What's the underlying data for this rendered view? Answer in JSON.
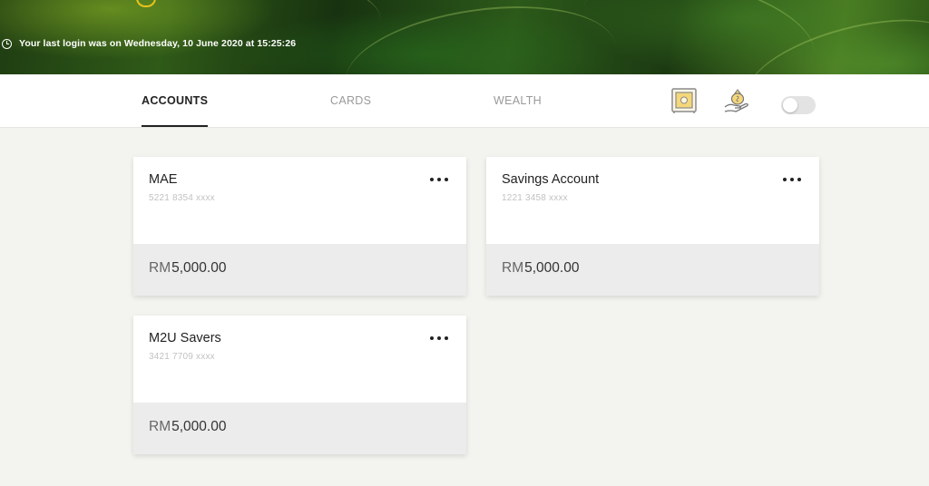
{
  "banner": {
    "last_login": "Your last login was on Wednesday, 10 June 2020 at 15:25:26"
  },
  "tabs": [
    {
      "label": "ACCOUNTS",
      "active": true
    },
    {
      "label": "CARDS",
      "active": false
    },
    {
      "label": "WEALTH",
      "active": false
    }
  ],
  "toolbar": {
    "icons": [
      "safe-icon",
      "money-bag-hand-icon"
    ],
    "toggle_on": false
  },
  "accounts": [
    {
      "name": "MAE",
      "number": "5221 8354 xxxx",
      "currency": "RM",
      "balance": "5,000.00"
    },
    {
      "name": "Savings Account",
      "number": "1221 3458 xxxx",
      "currency": "RM",
      "balance": "5,000.00"
    },
    {
      "name": "M2U Savers",
      "number": "3421 7709 xxxx",
      "currency": "RM",
      "balance": "5,000.00"
    }
  ],
  "colors": {
    "accent_dark": "#222222",
    "banner_green": "#2f5a18",
    "logo_yellow": "#e8c21c",
    "card_footer": "#ececec"
  }
}
